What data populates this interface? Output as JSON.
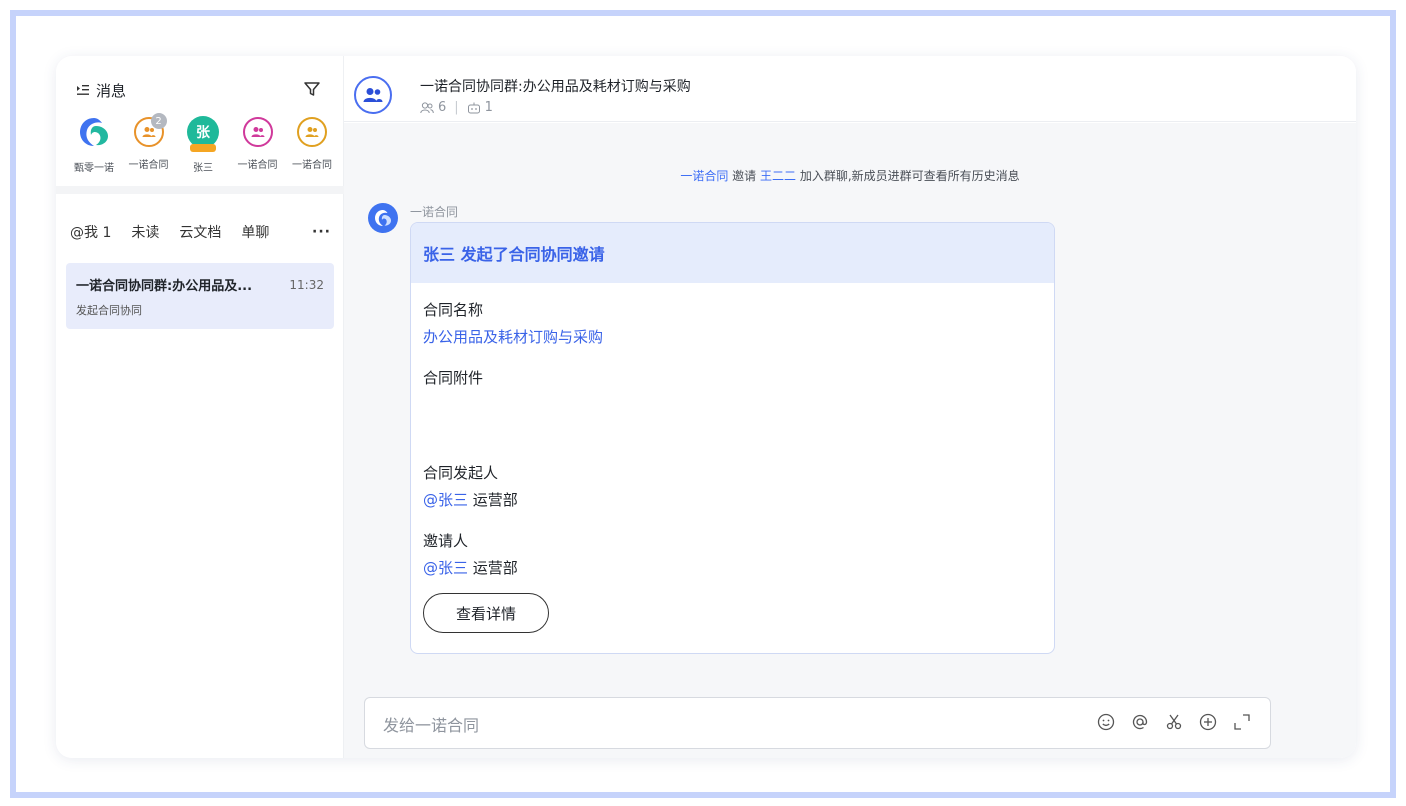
{
  "sidebar": {
    "title": "消息",
    "recent": [
      {
        "label": "甄零一诺",
        "kind": "logo"
      },
      {
        "label": "一诺合同",
        "kind": "group",
        "badge": "2",
        "color": "#e8922a"
      },
      {
        "label": "张三",
        "kind": "user",
        "initial": "张"
      },
      {
        "label": "一诺合同",
        "kind": "group",
        "color": "#d0399b"
      },
      {
        "label": "一诺合同",
        "kind": "group",
        "color": "#e0a020"
      }
    ],
    "tabs": [
      "@我 1",
      "未读",
      "云文档",
      "单聊"
    ],
    "more": "···",
    "conversations": [
      {
        "name": "一诺合同协同群:办公用品及...",
        "time": "11:32",
        "preview": "发起合同协同"
      }
    ]
  },
  "chat": {
    "title": "一诺合同协同群:办公用品及耗材订购与采购",
    "member_count": "6",
    "bot_count": "1",
    "system": {
      "inviter": "一诺合同",
      "verb": " 邀请 ",
      "invitee": "王二二",
      "rest": " 加入群聊,新成员进群可查看所有历史消息"
    },
    "sender": "一诺合同",
    "card": {
      "title": "张三 发起了合同协同邀请",
      "fields": [
        {
          "label": "合同名称",
          "value": "办公用品及耗材订购与采购"
        },
        {
          "label": "合同附件",
          "value": ""
        },
        {
          "label": "合同发起人",
          "mention": "@张三",
          "dept": " 运营部"
        },
        {
          "label": "邀请人",
          "mention": "@张三",
          "dept": " 运营部"
        }
      ],
      "button": "查看详情"
    },
    "input_placeholder": "发给一诺合同",
    "tools": [
      "emoji-icon",
      "at-icon",
      "scissors-icon",
      "plus-circle-icon",
      "expand-icon"
    ]
  },
  "colors": {
    "accent": "#3a63e8",
    "frame": "#c6d3fb",
    "selected": "#e8ecfb"
  }
}
